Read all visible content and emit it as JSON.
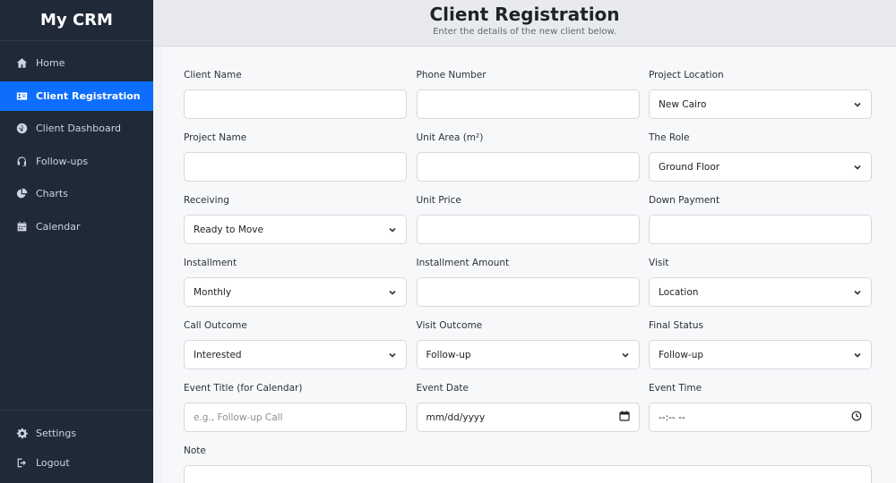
{
  "app": {
    "brand": "My CRM"
  },
  "sidebar": {
    "items": [
      {
        "label": "Home",
        "icon": "home-icon"
      },
      {
        "label": "Client Registration",
        "icon": "id-card-icon",
        "active": true
      },
      {
        "label": "Client Dashboard",
        "icon": "dashboard-icon"
      },
      {
        "label": "Follow-ups",
        "icon": "headset-icon"
      },
      {
        "label": "Charts",
        "icon": "pie-chart-icon"
      },
      {
        "label": "Calendar",
        "icon": "calendar-icon"
      }
    ],
    "bottom": [
      {
        "label": "Settings",
        "icon": "gear-icon"
      },
      {
        "label": "Logout",
        "icon": "logout-icon"
      }
    ]
  },
  "header": {
    "title": "Client Registration",
    "subtitle": "Enter the details of the new client below."
  },
  "form": {
    "fields": [
      {
        "label": "Client Name",
        "type": "text",
        "value": "",
        "placeholder": ""
      },
      {
        "label": "Phone Number",
        "type": "text",
        "value": "",
        "placeholder": ""
      },
      {
        "label": "Project Location",
        "type": "select",
        "value": "New Cairo"
      },
      {
        "label": "Project Name",
        "type": "text",
        "value": "",
        "placeholder": ""
      },
      {
        "label": "Unit Area (m²)",
        "type": "text",
        "value": "",
        "placeholder": ""
      },
      {
        "label": "The Role",
        "type": "select",
        "value": "Ground Floor"
      },
      {
        "label": "Receiving",
        "type": "select",
        "value": "Ready to Move"
      },
      {
        "label": "Unit Price",
        "type": "text",
        "value": "",
        "placeholder": ""
      },
      {
        "label": "Down Payment",
        "type": "text",
        "value": "",
        "placeholder": ""
      },
      {
        "label": "Installment",
        "type": "select",
        "value": "Monthly"
      },
      {
        "label": "Installment Amount",
        "type": "text",
        "value": "",
        "placeholder": ""
      },
      {
        "label": "Visit",
        "type": "select",
        "value": "Location"
      },
      {
        "label": "Call Outcome",
        "type": "select",
        "value": "Interested"
      },
      {
        "label": "Visit Outcome",
        "type": "select",
        "value": "Follow-up"
      },
      {
        "label": "Final Status",
        "type": "select",
        "value": "Follow-up"
      },
      {
        "label": "Event Title (for Calendar)",
        "type": "text",
        "value": "",
        "placeholder": "e.g., Follow-up Call"
      },
      {
        "label": "Event Date",
        "type": "date",
        "value": "",
        "placeholder": "mm/dd/yyyy"
      },
      {
        "label": "Event Time",
        "type": "time",
        "value": "",
        "placeholder": "--:-- --"
      }
    ],
    "note_label": "Note"
  },
  "colors": {
    "sidebar_bg": "#1f2937",
    "accent": "#0d6efd",
    "page_bg": "#f2f3f6"
  }
}
